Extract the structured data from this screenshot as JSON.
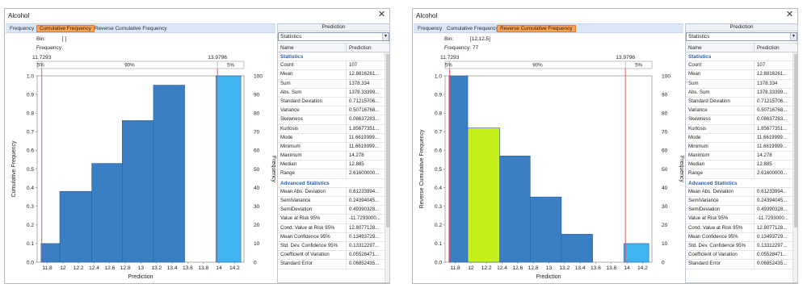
{
  "colors": {
    "bar": "#3a7ec3",
    "bar_right_tail": "#40b4f0",
    "bar_highlight": "#c5f01a",
    "marker_line": "#e34a4a",
    "tab_active": "#f7a35a",
    "section_header": "#2b5ea8"
  },
  "icons": {
    "close": "close-icon",
    "dropdown": "chevron-down-icon"
  },
  "windows": [
    {
      "title": "Alcohol",
      "close_glyph": "✕",
      "tabs": [
        {
          "label": "Frequency",
          "active": false
        },
        {
          "label": "Cumulative Frequency",
          "active": true
        },
        {
          "label": "Reverse Cumulative Frequency",
          "active": false
        }
      ],
      "bin_label": "Bin:",
      "bin_value": "[ ]",
      "freq_label": "Frequency:",
      "freq_value": "",
      "panel": {
        "header": "Prediction",
        "dropdown_value": "Statistics",
        "col_name": "Name",
        "col_value": "Prediction"
      },
      "chart_data": {
        "type": "bar",
        "xlabel": "Prediction",
        "ylabel_left": "Cumulative Frequency",
        "ylabel_right": "Frequency",
        "x_ticks": [
          "11.8",
          "12",
          "12.2",
          "12.4",
          "12.6",
          "12.8",
          "13",
          "13.2",
          "13.4",
          "13.6",
          "13.8",
          "14",
          "14.2"
        ],
        "y_ticks_left": [
          "0.0",
          "0.1",
          "0.2",
          "0.3",
          "0.4",
          "0.5",
          "0.6",
          "0.7",
          "0.8",
          "0.9",
          "1.0"
        ],
        "y_ticks_right": [
          "0",
          "10",
          "20",
          "30",
          "40",
          "50",
          "60",
          "70",
          "80",
          "90",
          "100"
        ],
        "xlim": [
          11.67,
          14.32
        ],
        "ylim": [
          0,
          1.0
        ],
        "bins": [
          {
            "x0": 11.72,
            "x1": 11.96,
            "value": 0.1,
            "style": "normal"
          },
          {
            "x0": 11.96,
            "x1": 12.37,
            "value": 0.38,
            "style": "normal"
          },
          {
            "x0": 12.37,
            "x1": 12.76,
            "value": 0.53,
            "style": "normal"
          },
          {
            "x0": 12.76,
            "x1": 13.16,
            "value": 0.76,
            "style": "normal"
          },
          {
            "x0": 13.16,
            "x1": 13.56,
            "value": 0.95,
            "style": "normal"
          },
          {
            "x0": 13.96,
            "x1": 14.28,
            "value": 1.0,
            "style": "tail"
          }
        ],
        "markers": {
          "left_value": 11.7293,
          "right_value": 13.9796,
          "left_label": "11.7293",
          "right_label": "13.9796",
          "left_pct": "5%",
          "middle_pct": "90%",
          "right_pct": "5%"
        }
      }
    },
    {
      "title": "Alcohol",
      "close_glyph": "✕",
      "tabs": [
        {
          "label": "Frequency",
          "active": false
        },
        {
          "label": "Cumulative Frequency",
          "active": false
        },
        {
          "label": "Reverse Cumulative Frequency",
          "active": true
        }
      ],
      "bin_label": "Bin:",
      "bin_value": "[12,12.5]",
      "freq_label": "Frequency:",
      "freq_value": "77",
      "panel": {
        "header": "Prediction",
        "dropdown_value": "Statistics",
        "col_name": "Name",
        "col_value": "Prediction"
      },
      "chart_data": {
        "type": "bar",
        "xlabel": "Prediction",
        "ylabel_left": "Reverse Cumulative Frequency",
        "ylabel_right": "Frequency",
        "x_ticks": [
          "11.8",
          "12",
          "12.2",
          "12.4",
          "12.6",
          "12.8",
          "13",
          "13.2",
          "13.4",
          "13.6",
          "13.8",
          "14",
          "14.2"
        ],
        "y_ticks_left": [
          "0.0",
          "0.1",
          "0.2",
          "0.3",
          "0.4",
          "0.5",
          "0.6",
          "0.7",
          "0.8",
          "0.9",
          "1.0"
        ],
        "y_ticks_right": [
          "0",
          "10",
          "20",
          "30",
          "40",
          "50",
          "60",
          "70",
          "80",
          "90",
          "100"
        ],
        "xlim": [
          11.67,
          14.32
        ],
        "ylim": [
          0,
          1.0
        ],
        "bins": [
          {
            "x0": 11.72,
            "x1": 11.96,
            "value": 1.0,
            "style": "normal"
          },
          {
            "x0": 11.96,
            "x1": 12.37,
            "value": 0.72,
            "style": "highlight"
          },
          {
            "x0": 12.37,
            "x1": 12.76,
            "value": 0.57,
            "style": "normal"
          },
          {
            "x0": 12.76,
            "x1": 13.16,
            "value": 0.35,
            "style": "normal"
          },
          {
            "x0": 13.16,
            "x1": 13.56,
            "value": 0.15,
            "style": "normal"
          },
          {
            "x0": 13.96,
            "x1": 14.28,
            "value": 0.1,
            "style": "tail"
          }
        ],
        "markers": {
          "left_value": 11.7293,
          "right_value": 13.9796,
          "left_label": "11.7293",
          "right_label": "13.9796",
          "left_pct": "5%",
          "middle_pct": "90%",
          "right_pct": "5%"
        }
      }
    }
  ],
  "stats_section": "Statistics",
  "advanced_section": "Advanced Statistics",
  "stats_rows": [
    {
      "name": "Count",
      "value": "107"
    },
    {
      "name": "Mean",
      "value": "12.8816261..."
    },
    {
      "name": "Sum",
      "value": "1378.334"
    },
    {
      "name": "Abs. Sum",
      "value": "1378.33399..."
    },
    {
      "name": "Standard Deviation",
      "value": "0.71215706..."
    },
    {
      "name": "Variance",
      "value": "0.50716768..."
    },
    {
      "name": "Skewness",
      "value": "0.08637283..."
    },
    {
      "name": "Kurtosis",
      "value": "1.85677351..."
    },
    {
      "name": "Mode",
      "value": "11.6619999..."
    },
    {
      "name": "Minimum",
      "value": "11.6619999..."
    },
    {
      "name": "Maximum",
      "value": "14.278"
    },
    {
      "name": "Median",
      "value": "12.885"
    },
    {
      "name": "Range",
      "value": "2.61600000..."
    }
  ],
  "advanced_rows": [
    {
      "name": "Mean Abs. Deviation",
      "value": "0.61233994..."
    },
    {
      "name": "SemiVariance",
      "value": "0.24394045..."
    },
    {
      "name": "SemiDeviation",
      "value": "0.49390328..."
    },
    {
      "name": "Value at Risk 95%",
      "value": "-11.7293000..."
    },
    {
      "name": "Cond. Value at Risk 95%",
      "value": "12.8077128..."
    },
    {
      "name": "Mean Confidence 95%",
      "value": "0.13493729..."
    },
    {
      "name": "Std. Dev. Confidence 95%",
      "value": "0.13312297..."
    },
    {
      "name": "Coefficient of Variation",
      "value": "0.05528471..."
    },
    {
      "name": "Standard Error",
      "value": "0.06852435..."
    }
  ]
}
